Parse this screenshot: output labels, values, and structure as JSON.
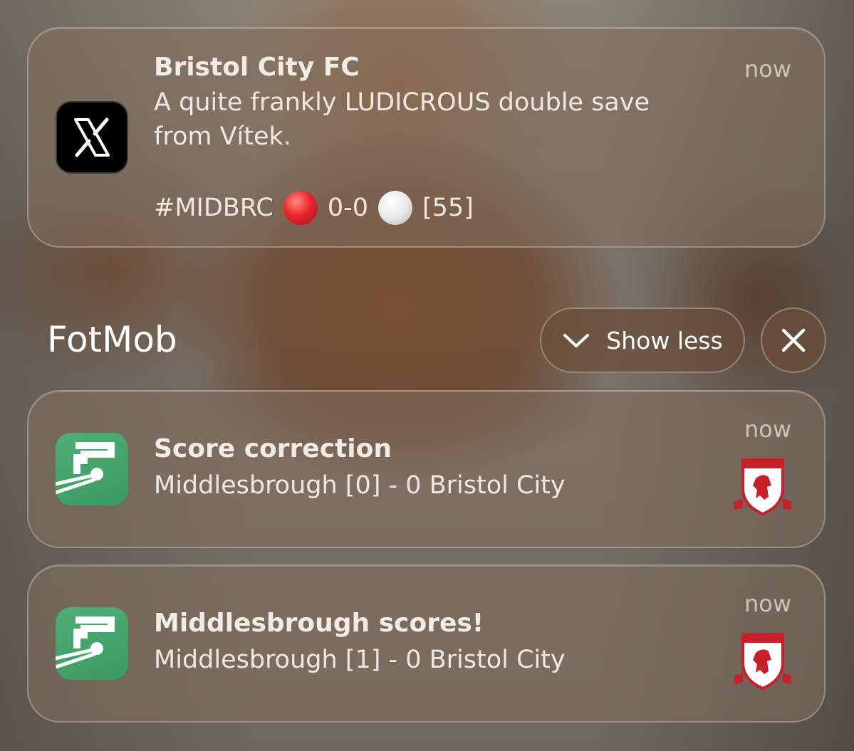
{
  "notifications": {
    "x_post": {
      "app_icon": "x-logo-icon",
      "title": "Bristol City FC",
      "time": "now",
      "body_line1": "A quite frankly LUDICROUS double save",
      "body_line2": "from Vítek.",
      "tag_prefix": "#MIDBRC",
      "tag_score": "0-0",
      "tag_minute": "[55]"
    },
    "group": {
      "app_name": "FotMob",
      "show_less_label": "Show less",
      "show_less_icon": "chevron-down-icon",
      "close_icon": "close-icon"
    },
    "fotmob_items": [
      {
        "title": "Score correction",
        "body": "Middlesbrough [0] - 0 Bristol City",
        "time": "now",
        "crest": "middlesbrough-crest-icon"
      },
      {
        "title": "Middlesbrough scores!",
        "body": "Middlesbrough [1] - 0 Bristol City",
        "time": "now",
        "crest": "middlesbrough-crest-icon"
      }
    ]
  },
  "colors": {
    "fotmob_green": "#3a9a62",
    "crest_red": "#c8202a",
    "red_dot": "#e8262a",
    "white_dot": "#e9e9e9"
  }
}
